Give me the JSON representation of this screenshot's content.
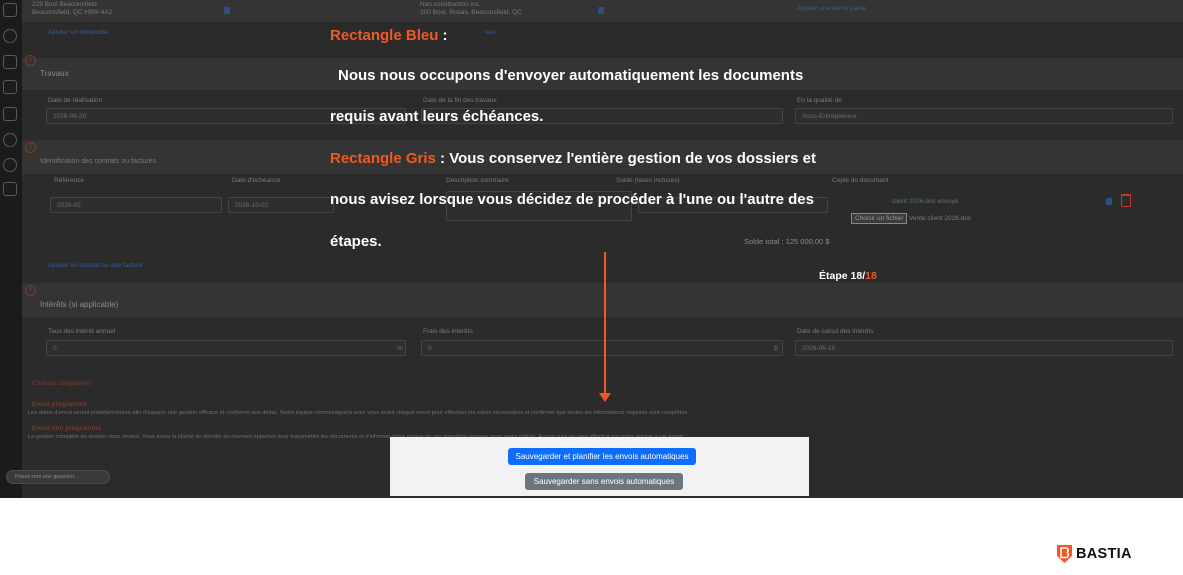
{
  "top_row": {
    "address_line1": "229 Boul Beaconsfield",
    "address_line2": "Beaconsfield, QC H9W 4A2",
    "company_line1": "Nan construction inc.",
    "company_line2": "200 Boul. Rosas, Beaconsfield, QC",
    "add_property_link": "Ajouter un immeuble",
    "add_third_party_link": "Ajouter une tierce partie",
    "add_link_partial": "leur"
  },
  "travaux": {
    "step": "2",
    "title": "Travaux",
    "date_realisation_label": "Date de réalisation",
    "date_realisation_value": "2026-08-26",
    "date_fin_label": "Date de la fin des travaux",
    "qualite_label": "En la qualité de",
    "qualite_value": "Sous-Entrepreneur"
  },
  "contrats": {
    "step": "3",
    "title": "Identification des contrats ou factures",
    "headers": [
      "Référence",
      "Date d'échéance",
      "Description sommaire",
      "Solde (taxes incluses)",
      "Copie du document"
    ],
    "reference_value": "2026-02",
    "echeance_value": "2026-10-02",
    "file_status": "client 2026.doc envoyé",
    "choose_file_button": "Choisir un fichier",
    "file_name": "Vente client 2026.doc",
    "solde_total": "Solde total : 125 000,00 $",
    "add_contract_link": "Ajouter un contrat ou une facture"
  },
  "interets": {
    "step": "4",
    "title": "Intérêts (si applicable)",
    "taux_label": "Taux des intérêt annuel",
    "taux_value": "0",
    "taux_suffix": "%",
    "frais_label": "Frais des intérêts",
    "frais_value": "0",
    "frais_suffix": "$",
    "date_calcul_label": "Date de calcul des intérêts",
    "date_calcul_value": "2026-06-10"
  },
  "notes": {
    "required": "Champs obligatoires",
    "programmed_title": "Envoi programmé",
    "programmed_text": "Les dates d'envoi seront prédéterminées afin d'assurer une gestion efficace et conforme aux délais. Notre équipe communiquera avec vous avant chaque envoi pour effectuer les suivis nécessaires et confirmer que toutes les informations requises sont complètes.",
    "not_programmed_title": "Envoi non programmé",
    "not_programmed_text": "La gestion complète du dossier vous revient. Vous aurez la liberté de décider du moment opportun pour transmettre les documents et d'informer notre équipe de vos intentions lorsque vous serez prêt(e). Aucun suivi ne sera effectué par notre équipe à cet égard."
  },
  "overlay": {
    "blue_label": "Rectangle Bleu",
    "blue_colon": " :",
    "line2": "Nous nous occupons d'envoyer automatiquement les documents",
    "line3": "requis avant leurs échéances.",
    "gray_label": "Rectangle Gris",
    "gray_rest": " : Vous conservez l'entière gestion de vos dossiers et",
    "line5": "nous avisez lorsque vous décidez de procéder à l'une ou l'autre des",
    "line6": "étapes.",
    "step_prefix": "Étape 18/",
    "step_total": "18"
  },
  "actions": {
    "save_schedule": "Sauvegarder et planifier les envois automatiques",
    "save_no_schedule": "Sauvegarder sans envois automatiques"
  },
  "chat_placeholder": "Posez-moi une question...",
  "brand": {
    "name": "BASTIA",
    "accent": "#f05a22",
    "button_blue": "#0d6efd",
    "button_gray": "#6c757d"
  }
}
